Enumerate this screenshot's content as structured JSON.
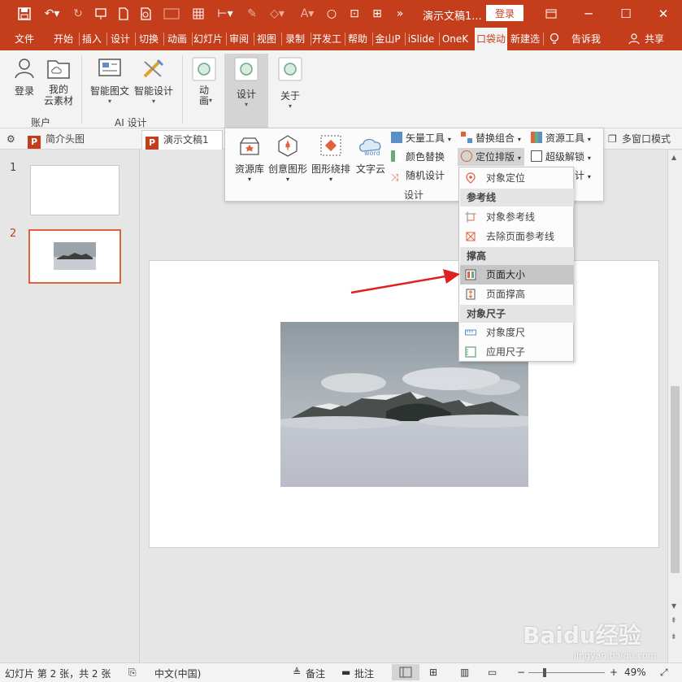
{
  "titlebar": {
    "doc_title": "演示文稿1...",
    "login_label": "登录"
  },
  "tabs": [
    "文件",
    "开始",
    "插入",
    "设计",
    "切换",
    "动画",
    "幻灯片",
    "审阅",
    "视图",
    "录制",
    "开发工",
    "帮助",
    "金山P",
    "iSlide",
    "OneK",
    "口袋动",
    "新建选",
    "告诉我",
    "共享"
  ],
  "ribbon": {
    "account": {
      "login": "登录",
      "my_material": "我的\n云素材",
      "group": "账户"
    },
    "ai": {
      "smart_graphic": "智能图文",
      "smart_design": "智能设计",
      "group": "AI 设计"
    },
    "animation": "动\n画",
    "design": "设计",
    "about": "关于"
  },
  "doctabs": {
    "tab1": "简介头图",
    "tab2": "演示文稿1",
    "multiwindow": "多窗口模式"
  },
  "design_panel": {
    "resource_lib": "资源库",
    "creative_shape": "创意图形",
    "shape_wrap": "图形绕排",
    "word_cloud": "文字云",
    "vector_tools": "矢量工具",
    "color_replace": "颜色替换",
    "random_design": "随机设计",
    "replace_combine": "替换组合",
    "position_layout": "定位排版",
    "resource_tools": "资源工具",
    "super_unlock": "超级解锁",
    "design_partial": "计",
    "group_label": "设计",
    "word_icon": "word"
  },
  "context_menu": {
    "object_locate": "对象定位",
    "ref_line_header": "参考线",
    "object_ref_line": "对象参考线",
    "remove_page_ref_line": "去除页面参考线",
    "stretch_header": "撑高",
    "page_size": "页面大小",
    "page_stretch": "页面撑高",
    "ruler_header": "对象尺子",
    "object_ruler": "对象度尺",
    "apply_ruler": "应用尺子"
  },
  "thumbnails": {
    "num1": "1",
    "num2": "2"
  },
  "statusbar": {
    "slide_info": "幻灯片 第 2 张，共 2 张",
    "language": "中文(中国)",
    "notes": "备注",
    "comments": "批注",
    "zoom": "49%"
  },
  "watermark": {
    "main": "Baidu经验",
    "sub": "jingyan.baidu.com"
  },
  "colors": {
    "accent": "#c43e1c",
    "highlight": "#c6c6c6",
    "arrow": "#e02020"
  }
}
